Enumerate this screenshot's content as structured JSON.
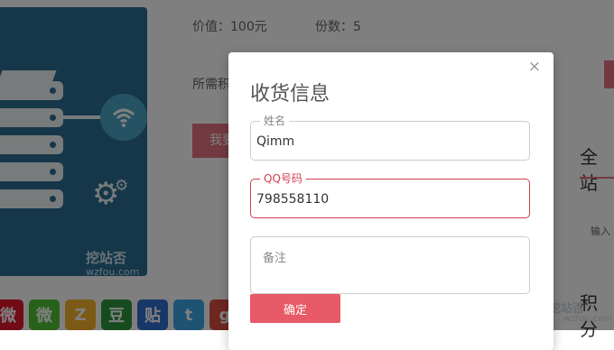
{
  "product": {
    "price_label": "价值：100元",
    "count_label": "份数：5",
    "required_label": "所需积",
    "buy_button": "我要",
    "watermark_main": "挖站否",
    "watermark_sub": "wzfou.com"
  },
  "sidebar": {
    "title": "全站",
    "input_label": "输入",
    "title2": "积分",
    "watermark_main": "挖站否",
    "watermark_sub": "wzfou.com"
  },
  "share": {
    "icons": [
      {
        "name": "weibo-icon",
        "glyph": "微",
        "color": "#e6162d"
      },
      {
        "name": "wechat-icon",
        "glyph": "微",
        "color": "#51c332"
      },
      {
        "name": "qzone-icon",
        "glyph": "Z",
        "color": "#f8b42c"
      },
      {
        "name": "douban-icon",
        "glyph": "豆",
        "color": "#2e963d"
      },
      {
        "name": "tieba-icon",
        "glyph": "贴",
        "color": "#2f6fd1"
      },
      {
        "name": "twitter-icon",
        "glyph": "t",
        "color": "#3fa6e8"
      },
      {
        "name": "google-plus-icon",
        "glyph": "g",
        "color": "#dc4e41"
      }
    ]
  },
  "modal": {
    "title": "收货信息",
    "close": "×",
    "name_label": "姓名",
    "name_value": "Qimm",
    "qq_label": "QQ号码",
    "qq_value": "798558110",
    "note_label": "备注",
    "confirm": "确定"
  }
}
